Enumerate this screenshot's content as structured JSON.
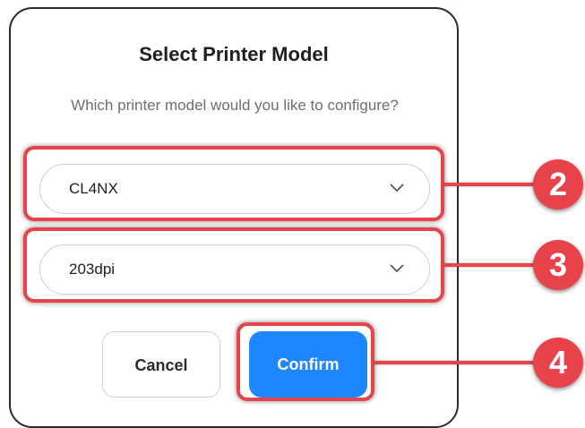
{
  "dialog": {
    "title": "Select Printer Model",
    "subtitle": "Which printer model would you like to configure?"
  },
  "model_select": {
    "value": "CL4NX",
    "icon": "chevron-down-icon"
  },
  "dpi_select": {
    "value": "203dpi",
    "icon": "chevron-down-icon"
  },
  "buttons": {
    "cancel_label": "Cancel",
    "confirm_label": "Confirm"
  },
  "annotations": {
    "color": "#e8434a",
    "callouts": [
      {
        "label": "2",
        "target": "model_select"
      },
      {
        "label": "3",
        "target": "dpi_select"
      },
      {
        "label": "4",
        "target": "confirm_button"
      }
    ]
  },
  "colors": {
    "accent": "#1e86ff",
    "highlight": "#e8434a"
  }
}
